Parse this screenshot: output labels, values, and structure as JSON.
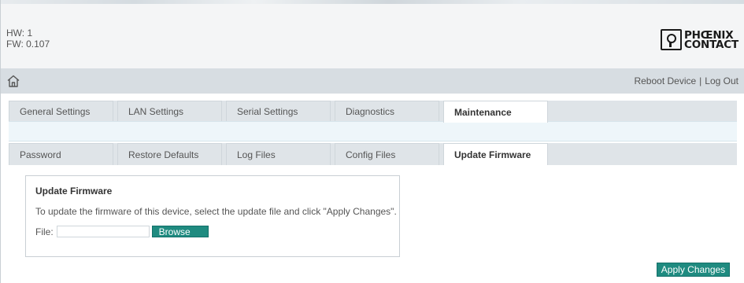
{
  "header": {
    "hw": "HW: 1",
    "fw": "FW: 0.107",
    "logo_line1": "PHŒNIX",
    "logo_line2": "CONTACT"
  },
  "navbar": {
    "home_icon": "home-icon",
    "reboot_label": "Reboot Device",
    "separator": "|",
    "logout_label": "Log Out"
  },
  "main_tabs": [
    {
      "label": "General Settings",
      "active": false
    },
    {
      "label": "LAN Settings",
      "active": false
    },
    {
      "label": "Serial Settings",
      "active": false
    },
    {
      "label": "Diagnostics",
      "active": false
    },
    {
      "label": "Maintenance",
      "active": true
    }
  ],
  "sub_tabs": [
    {
      "label": "Password",
      "active": false
    },
    {
      "label": "Restore Defaults",
      "active": false
    },
    {
      "label": "Log Files",
      "active": false
    },
    {
      "label": "Config Files",
      "active": false
    },
    {
      "label": "Update Firmware",
      "active": true
    }
  ],
  "panel": {
    "title": "Update Firmware",
    "description": "To update the firmware of this device, select the update file and click \"Apply Changes\".",
    "file_label": "File:",
    "file_value": "",
    "browse_label": "Browse"
  },
  "apply_label": "Apply Changes",
  "colors": {
    "accent": "#1f8b80",
    "tab_bg": "#dfe4e8",
    "navbar_bg": "#d7dde2"
  }
}
